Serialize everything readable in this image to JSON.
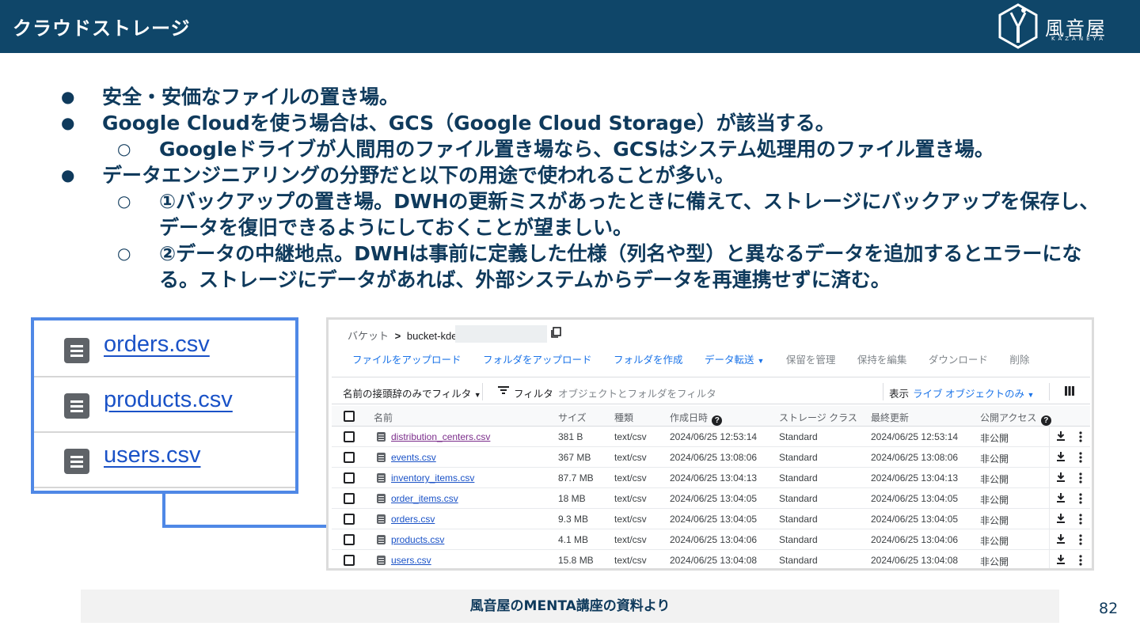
{
  "header": {
    "title": "クラウドストレージ",
    "logo_text": "風音屋",
    "logo_sub": "KAZANEYA"
  },
  "bullets": [
    {
      "level": 1,
      "marker": "●",
      "text": "安全・安価なファイルの置き場。"
    },
    {
      "level": 1,
      "marker": "●",
      "text": "Google Cloudを使う場合は、GCS（Google Cloud Storage）が該当する。"
    },
    {
      "level": 2,
      "marker": "○",
      "text": "Googleドライブが人間用のファイル置き場なら、GCSはシステム処理用のファイル置き場。"
    },
    {
      "level": 1,
      "marker": "●",
      "text": "データエンジニアリングの分野だと以下の用途で使われることが多い。"
    },
    {
      "level": 2,
      "marker": "○",
      "text": "①バックアップの置き場。DWHの更新ミスがあったときに備えて、ストレージにバックアップを保存し、データを復旧できるようにしておくことが望ましい。"
    },
    {
      "level": 2,
      "marker": "○",
      "text": "②データの中継地点。DWHは事前に定義した仕様（列名や型）と異なるデータを追加するとエラーになる。ストレージにデータがあれば、外部システムからデータを再連携せずに済む。"
    }
  ],
  "zoom_files": [
    "orders.csv",
    "products.csv",
    "users.csv"
  ],
  "gcs": {
    "breadcrumb_root": "バケット",
    "breadcrumb_sep": ">",
    "bucket_name": "bucket-kdec-",
    "toolbar": {
      "upload_files": "ファイルをアップロード",
      "upload_folder": "フォルダをアップロード",
      "create_folder": "フォルダを作成",
      "transfer": "データ転送",
      "manage_holds": "保留を管理",
      "edit_retention": "保持を編集",
      "download": "ダウンロード",
      "delete": "削除"
    },
    "filter": {
      "prefix_filter": "名前の接頭辞のみでフィルタ",
      "filter_label": "フィルタ",
      "filter_placeholder": "オブジェクトとフォルダをフィルタ",
      "show_label": "表示",
      "show_value": "ライブ オブジェクトのみ"
    },
    "columns": {
      "name": "名前",
      "size": "サイズ",
      "type": "種類",
      "created": "作成日時",
      "storage_class": "ストレージ クラス",
      "updated": "最終更新",
      "public_access": "公開アクセス"
    },
    "rows": [
      {
        "name": "distribution_centers.csv",
        "size": "381 B",
        "type": "text/csv",
        "created": "2024/06/25 12:53:14",
        "storage_class": "Standard",
        "updated": "2024/06/25 12:53:14",
        "public_access": "非公開"
      },
      {
        "name": "events.csv",
        "size": "367 MB",
        "type": "text/csv",
        "created": "2024/06/25 13:08:06",
        "storage_class": "Standard",
        "updated": "2024/06/25 13:08:06",
        "public_access": "非公開"
      },
      {
        "name": "inventory_items.csv",
        "size": "87.7 MB",
        "type": "text/csv",
        "created": "2024/06/25 13:04:13",
        "storage_class": "Standard",
        "updated": "2024/06/25 13:04:13",
        "public_access": "非公開"
      },
      {
        "name": "order_items.csv",
        "size": "18 MB",
        "type": "text/csv",
        "created": "2024/06/25 13:04:05",
        "storage_class": "Standard",
        "updated": "2024/06/25 13:04:05",
        "public_access": "非公開"
      },
      {
        "name": "orders.csv",
        "size": "9.3 MB",
        "type": "text/csv",
        "created": "2024/06/25 13:04:05",
        "storage_class": "Standard",
        "updated": "2024/06/25 13:04:05",
        "public_access": "非公開"
      },
      {
        "name": "products.csv",
        "size": "4.1 MB",
        "type": "text/csv",
        "created": "2024/06/25 13:04:06",
        "storage_class": "Standard",
        "updated": "2024/06/25 13:04:06",
        "public_access": "非公開"
      },
      {
        "name": "users.csv",
        "size": "15.8 MB",
        "type": "text/csv",
        "created": "2024/06/25 13:04:08",
        "storage_class": "Standard",
        "updated": "2024/06/25 13:04:08",
        "public_access": "非公開"
      }
    ]
  },
  "source_caption": "風音屋のMENTA講座の資料より",
  "page_number": "82",
  "colors": {
    "header_bg": "#0f4669",
    "accent": "#4f88e6",
    "link": "#1a52c7"
  }
}
